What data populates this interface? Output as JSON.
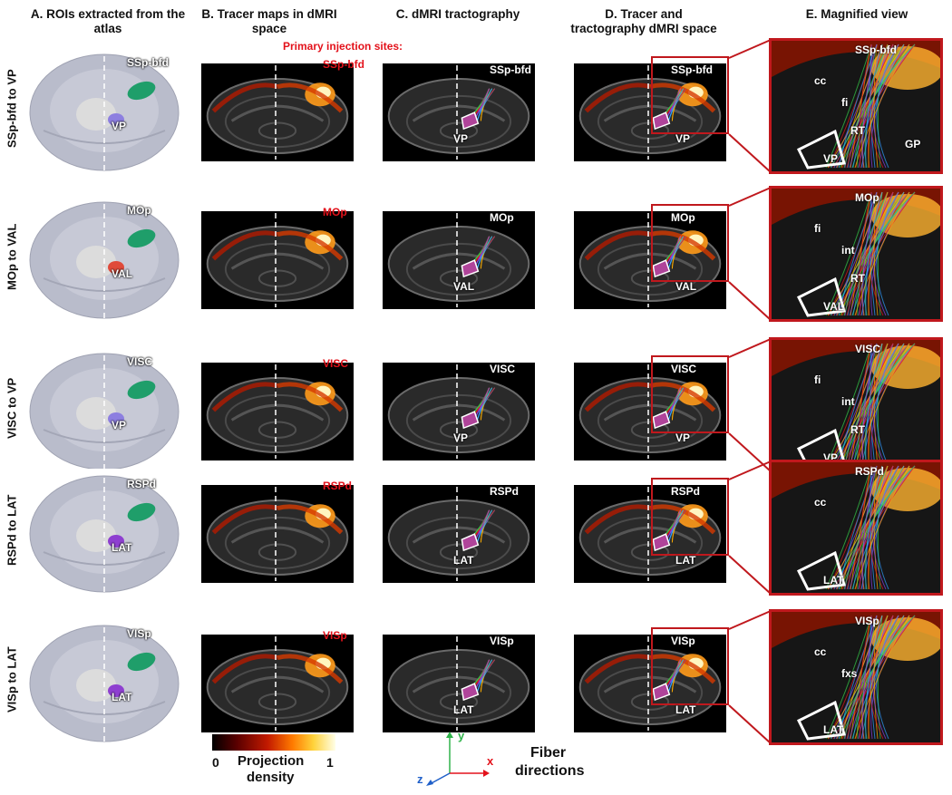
{
  "columns": {
    "a": "A. ROIs extracted from the atlas",
    "b": "B. Tracer maps in dMRI space",
    "c": "C. dMRI tractography",
    "d": "D. Tracer and tractography dMRI space",
    "e": "E. Magnified view"
  },
  "rows": [
    {
      "label": "SSp-bfd to VP",
      "source": "SSp-bfd",
      "target": "VP",
      "source_color": "#1f9e6a",
      "target_color": "#8d7fe0",
      "tracer_label": "SSp-bfd",
      "extra_tracer_label": "Primary injection sites:",
      "magnified_labels": {
        "top": "SSp-bfd",
        "a": "cc",
        "b": "fi",
        "c": "RT",
        "d": "VP",
        "e": "GP"
      }
    },
    {
      "label": "MOp to VAL",
      "source": "MOp",
      "target": "VAL",
      "source_color": "#1f9e6a",
      "target_color": "#e04a3a",
      "tracer_label": "MOp",
      "extra_tracer_label": "",
      "magnified_labels": {
        "top": "MOp",
        "a": "fi",
        "b": "int",
        "c": "RT",
        "d": "VAL"
      }
    },
    {
      "label": "VISC to VP",
      "source": "VISC",
      "target": "VP",
      "source_color": "#1f9e6a",
      "target_color": "#8d7fe0",
      "tracer_label": "VISC",
      "extra_tracer_label": "",
      "magnified_labels": {
        "top": "VISC",
        "a": "fi",
        "b": "int",
        "c": "RT",
        "d": "VP"
      }
    },
    {
      "label": "RSPd to LAT",
      "source": "RSPd",
      "target": "LAT",
      "source_color": "#1f9e6a",
      "target_color": "#8e3fd0",
      "tracer_label": "RSPd",
      "extra_tracer_label": "",
      "magnified_labels": {
        "top": "RSPd",
        "a": "cc",
        "d": "LAT"
      }
    },
    {
      "label": "VISp to LAT",
      "source": "VISp",
      "target": "LAT",
      "source_color": "#1f9e6a",
      "target_color": "#8e3fd0",
      "tracer_label": "VISp",
      "extra_tracer_label": "",
      "magnified_labels": {
        "top": "VISp",
        "a": "cc",
        "b": "fxs",
        "d": "LAT"
      }
    }
  ],
  "legend": {
    "colorbar_min": "0",
    "colorbar_max": "1",
    "colorbar_label_line1": "Projection",
    "colorbar_label_line2": "density",
    "axis_x": "x",
    "axis_y": "y",
    "axis_z": "z",
    "fiber_label_line1": "Fiber",
    "fiber_label_line2": "directions"
  },
  "colors": {
    "frame_red": "#c0181d",
    "label_red": "#e3121b",
    "atlas_green": "#1f9e6a",
    "fiber_green": "#35d14a"
  }
}
